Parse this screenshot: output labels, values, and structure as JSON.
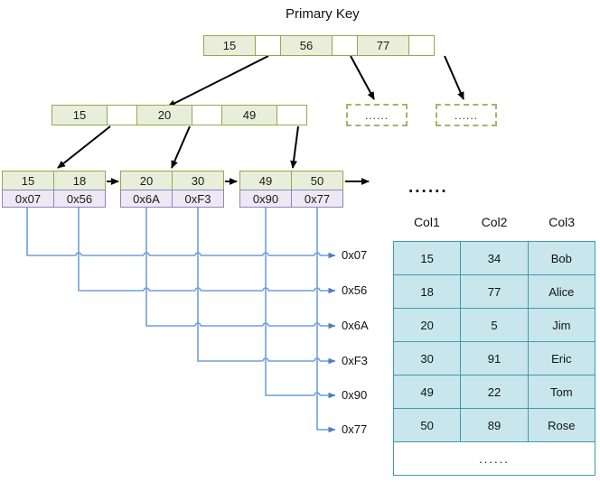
{
  "title": "Primary Key",
  "colors": {
    "node_fill": "#e9eeda",
    "node_border": "#94a84d",
    "pointer_fill": "#ece9f5",
    "pointer_border": "#9183bb",
    "table_fill": "#c9e6ed",
    "table_border": "#3d9aad",
    "wire": "#6f9fd8",
    "arrow": "#000000"
  },
  "root_node": {
    "cells": [
      "15",
      "",
      "56",
      "",
      "77",
      ""
    ]
  },
  "internal_node": {
    "cells": [
      "15",
      "",
      "20",
      "",
      "49",
      ""
    ]
  },
  "placeholder_nodes": [
    {
      "text": "......"
    },
    {
      "text": "......"
    }
  ],
  "leaf_ellipsis": "......",
  "leaves": [
    {
      "keys": [
        "15",
        "18"
      ],
      "pointers": [
        "0x07",
        "0x56"
      ]
    },
    {
      "keys": [
        "20",
        "30"
      ],
      "pointers": [
        "0x6A",
        "0xF3"
      ]
    },
    {
      "keys": [
        "49",
        "50"
      ],
      "pointers": [
        "0x90",
        "0x77"
      ]
    }
  ],
  "address_labels": [
    "0x07",
    "0x56",
    "0x6A",
    "0xF3",
    "0x90",
    "0x77"
  ],
  "record_table": {
    "headers": [
      "Col1",
      "Col2",
      "Col3"
    ],
    "rows": [
      [
        "15",
        "34",
        "Bob"
      ],
      [
        "18",
        "77",
        "Alice"
      ],
      [
        "20",
        "5",
        "Jim"
      ],
      [
        "30",
        "91",
        "Eric"
      ],
      [
        "49",
        "22",
        "Tom"
      ],
      [
        "50",
        "89",
        "Rose"
      ]
    ],
    "more_row": "......"
  }
}
